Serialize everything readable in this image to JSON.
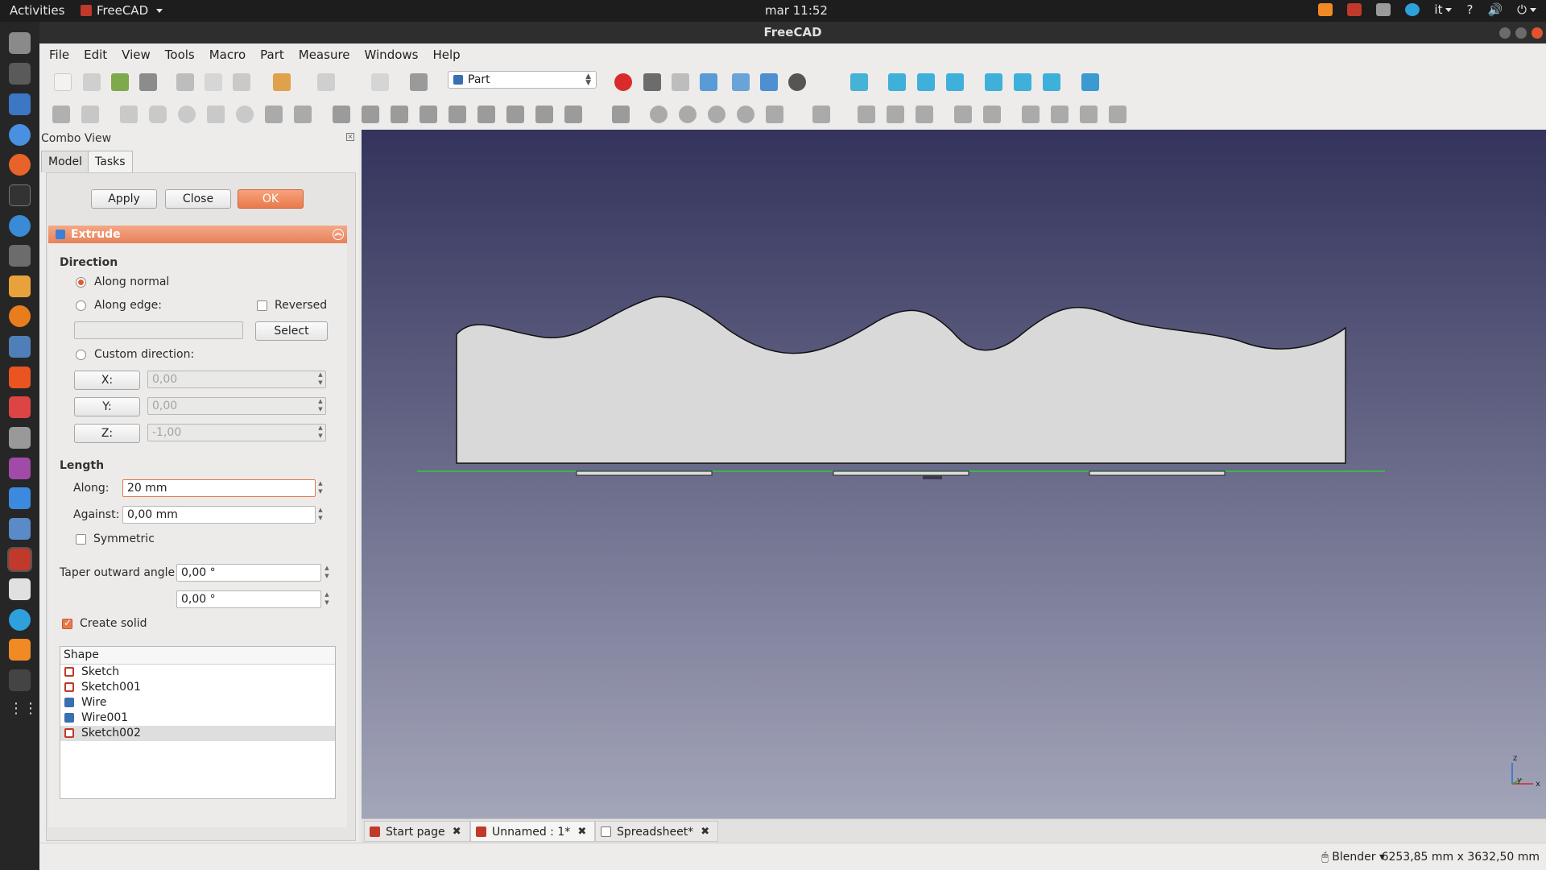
{
  "topbar": {
    "activities": "Activities",
    "app_name": "FreeCAD",
    "clock": "mar 11:52",
    "lang": "it",
    "help": "?"
  },
  "window": {
    "title": "FreeCAD"
  },
  "menu": [
    "File",
    "Edit",
    "View",
    "Tools",
    "Macro",
    "Part",
    "Measure",
    "Windows",
    "Help"
  ],
  "workbench": {
    "selected": "Part"
  },
  "combo": {
    "title": "Combo View",
    "tabs": {
      "model": "Model",
      "tasks": "Tasks"
    }
  },
  "task_buttons": {
    "apply": "Apply",
    "close": "Close",
    "ok": "OK"
  },
  "extrude": {
    "title": "Extrude",
    "direction_label": "Direction",
    "along_normal": "Along normal",
    "along_edge": "Along edge:",
    "reversed": "Reversed",
    "select": "Select",
    "custom_direction": "Custom direction:",
    "x_label": "X:",
    "x_value": "0,00",
    "y_label": "Y:",
    "y_value": "0,00",
    "z_label": "Z:",
    "z_value": "-1,00",
    "length_label": "Length",
    "along_label": "Along:",
    "along_value": "20 mm",
    "against_label": "Against:",
    "against_value": "0,00 mm",
    "symmetric": "Symmetric",
    "taper_label": "Taper outward angle",
    "taper1": "0,00 °",
    "taper2": "0,00 °",
    "create_solid": "Create solid"
  },
  "shape_list": {
    "header": "Shape",
    "items": [
      {
        "label": "Sketch",
        "type": "sketch"
      },
      {
        "label": "Sketch001",
        "type": "sketch"
      },
      {
        "label": "Wire",
        "type": "wire"
      },
      {
        "label": "Wire001",
        "type": "wire"
      },
      {
        "label": "Sketch002",
        "type": "sketch",
        "selected": true
      }
    ]
  },
  "doc_tabs": [
    "Start page",
    "Unnamed : 1*",
    "Spreadsheet*"
  ],
  "status": {
    "nav_style": "Blender",
    "dimensions": "6253,85 mm x 3632,50 mm"
  },
  "colors": {
    "accent": "#e8794b",
    "view_top": "#33335c",
    "view_bottom": "#a3a5b9",
    "baseline": "#3bb54a"
  },
  "axis_labels": {
    "z": "z",
    "y": "y",
    "x": "x"
  }
}
